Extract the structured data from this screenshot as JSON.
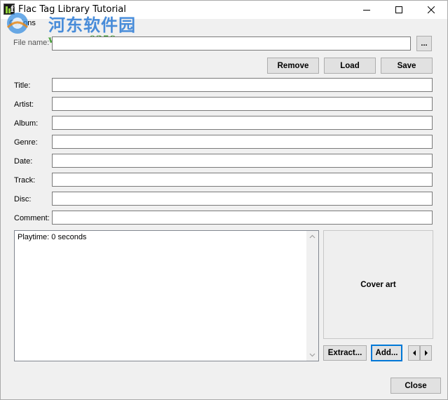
{
  "window": {
    "title": "Flac Tag Library Tutorial"
  },
  "menu": {
    "options_label": "Options"
  },
  "watermark": {
    "cn_text": "河东软件园",
    "url_text": "www.pc0359.cn"
  },
  "file": {
    "label": "File name:",
    "value": "",
    "browse_label": "..."
  },
  "actions": {
    "remove_label": "Remove",
    "load_label": "Load",
    "save_label": "Save"
  },
  "fields": [
    {
      "label": "Title:",
      "value": ""
    },
    {
      "label": "Artist:",
      "value": ""
    },
    {
      "label": "Album:",
      "value": ""
    },
    {
      "label": "Genre:",
      "value": ""
    },
    {
      "label": "Date:",
      "value": ""
    },
    {
      "label": "Track:",
      "value": ""
    },
    {
      "label": "Disc:",
      "value": ""
    },
    {
      "label": "Comment:",
      "value": ""
    }
  ],
  "info": {
    "text": "Playtime: 0 seconds"
  },
  "cover": {
    "label": "Cover art",
    "extract_label": "Extract...",
    "add_label": "Add..."
  },
  "footer": {
    "close_label": "Close"
  },
  "colors": {
    "focus": "#0078d7",
    "watermark_blue": "#2b7bd6",
    "watermark_green": "#3c9a2b"
  }
}
